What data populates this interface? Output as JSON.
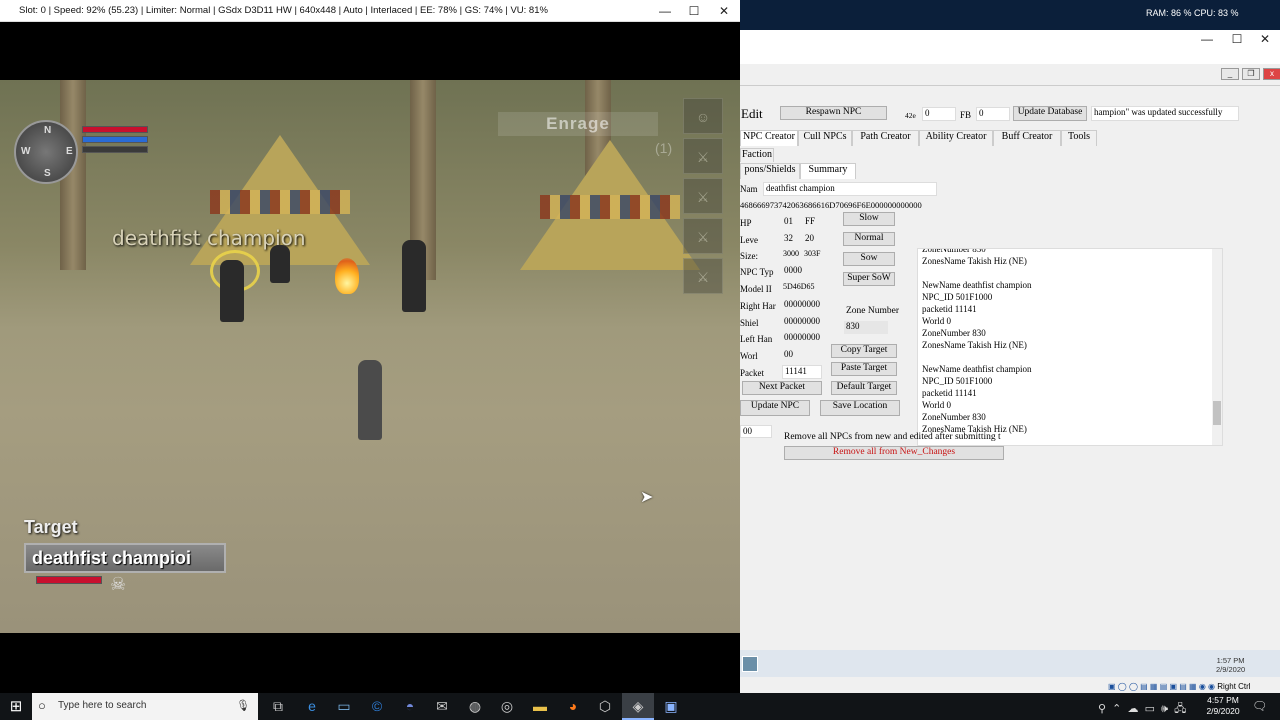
{
  "emulator": {
    "title": "Slot: 0 | Speed:  92% (55.23) | Limiter: Normal | GSdx D3D11 HW | 640x448 | Auto | Interlaced | EE:  78% | GS:  74% | VU:  81%",
    "controls": {
      "minimize": "—",
      "maximize": "☐",
      "close": "✕"
    }
  },
  "game": {
    "compass": {
      "n": "N",
      "e": "E",
      "s": "S",
      "w": "W"
    },
    "buff_label": "Enrage",
    "buff_counter": "(1)",
    "npc_nameplate": "deathfist champion",
    "target_title": "Target",
    "target_name": "deathfist champioi",
    "target_icon": "skull-icon",
    "bar_colors": {
      "health": "#c8102e",
      "power": "#2a6bd6",
      "concentration": "#3a3a3a"
    }
  },
  "system_overlay": {
    "ram_cpu": "RAM: 86 %  CPU: 83 %"
  },
  "editor": {
    "title": "Edit",
    "respawn_button": "Respawn NPC",
    "field_42e_label": "42e",
    "field_42e_value": "0",
    "field_fb_label": "FB",
    "field_fb_value": "0",
    "update_database_button": "Update Database",
    "status_message": "hampion\" was updated successfully",
    "tabs": [
      "NPC Creator",
      "Cull NPCs",
      "Path Creator",
      "Ability Creator",
      "Buff Creator",
      "Tools"
    ],
    "faction_tab": "Faction",
    "subtabs": [
      "pons/Shields",
      "Summary"
    ],
    "name_label": "Nam",
    "name_value": "deathfist champion",
    "hex_string": "468666973742063686616D70696F6E000000000000",
    "rows": {
      "hp": {
        "label": "HP",
        "v1": "01",
        "v2": "FF"
      },
      "level": {
        "label": "Leve",
        "v1": "32",
        "v2": "20"
      },
      "size": {
        "label": "Size:",
        "v1": "3000",
        "v2": "303F"
      },
      "npc_type": {
        "label": "NPC Typ",
        "v1": "0000"
      },
      "model_id": {
        "label": "Model II",
        "v1": "5D46D65"
      },
      "right_hand": {
        "label": "Right Har",
        "v1": "00000000"
      },
      "shield": {
        "label": "Shiel",
        "v1": "00000000"
      },
      "left_hand": {
        "label": "Left Han",
        "v1": "00000000"
      },
      "world": {
        "label": "Worl",
        "v1": "00"
      },
      "packet": {
        "label": "Packet",
        "v1": "11141"
      }
    },
    "speed_buttons": [
      "Slow",
      "Normal",
      "Sow",
      "Super SoW"
    ],
    "zone_number_label": "Zone Number",
    "zone_number_value": "830",
    "copy_target": "Copy Target",
    "paste_target": "Paste Target",
    "next_packet": "Next Packet",
    "default_target": "Default Target",
    "update_npc": "Update NPC",
    "save_location": "Save Location",
    "summary_lines": [
      "ZoneNumber 830",
      "ZonesName Takish Hiz (NE)",
      "",
      "NewName deathfist champion",
      "NPC_ID 501F1000",
      "packetid 11141",
      "World 0",
      "ZoneNumber 830",
      "ZonesName Takish Hiz (NE)",
      "",
      "NewName deathfist champion",
      "NPC_ID 501F1000",
      "packetid 11141",
      "World 0",
      "ZoneNumber 830",
      "ZonesName Takish Hiz (NE)"
    ],
    "small_field_value": "00",
    "remove_info": "Remove all NPCs from new and edited after submitting t",
    "remove_button": "Remove all from New_Changes",
    "inner_clock_time": "1:57 PM",
    "inner_clock_date": "2/9/2020",
    "tray_right_label": "Right Ctrl"
  },
  "taskbar": {
    "search_placeholder": "Type here to search",
    "apps": [
      "task-view",
      "edge",
      "notepad",
      "ccleaner",
      "discord",
      "mail",
      "steam",
      "davinci",
      "explorer",
      "firefox",
      "unity",
      "pcsx2",
      "vs"
    ],
    "clock_time": "4:57 PM",
    "clock_date": "2/9/2020"
  }
}
